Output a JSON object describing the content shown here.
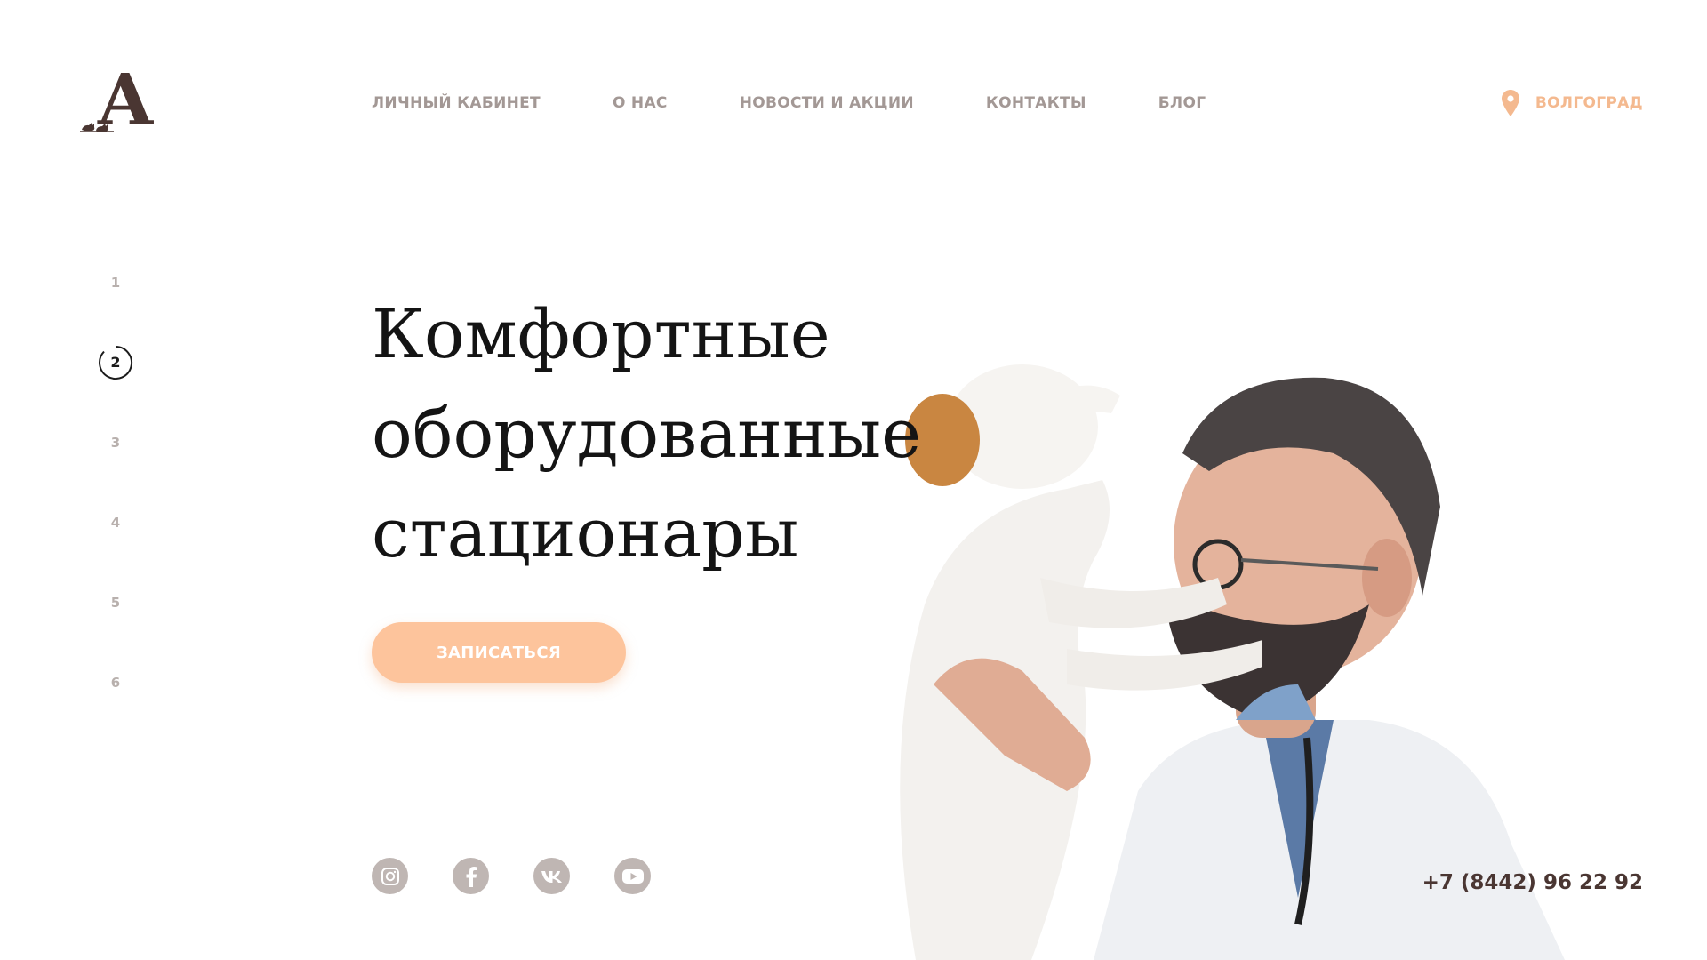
{
  "brand": {
    "logo_letter": "A",
    "color_primary": "#4a3632",
    "color_accent": "#fdc49c",
    "color_city": "#f4b98f"
  },
  "nav": {
    "items": [
      {
        "label": "ЛИЧНЫЙ КАБИНЕТ"
      },
      {
        "label": "О НАС"
      },
      {
        "label": "НОВОСТИ И АКЦИИ"
      },
      {
        "label": "КОНТАКТЫ"
      },
      {
        "label": "БЛОГ"
      }
    ]
  },
  "city": {
    "label": "ВОЛГОГРАД",
    "icon": "map-pin-icon"
  },
  "slider": {
    "items": [
      "1",
      "2",
      "3",
      "4",
      "5",
      "6"
    ],
    "active": "2"
  },
  "hero": {
    "lines": [
      "Комфортные",
      "оборудованные",
      "стационары"
    ],
    "cta_label": "ЗАПИСАТЬСЯ",
    "image": "veterinarian-with-dog-photo"
  },
  "socials": [
    {
      "icon": "instagram-icon"
    },
    {
      "icon": "facebook-icon"
    },
    {
      "icon": "vk-icon"
    },
    {
      "icon": "youtube-icon"
    }
  ],
  "phone": "+7 (8442) 96 22 92"
}
